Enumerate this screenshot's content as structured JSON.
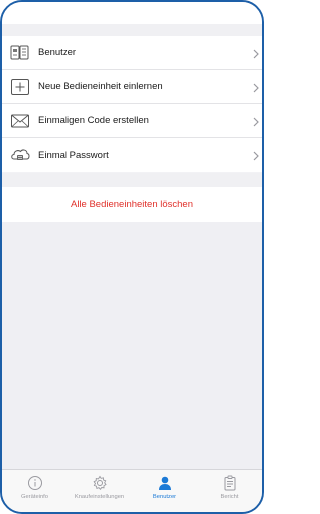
{
  "menu": {
    "items": [
      {
        "label": "Benutzer",
        "icon": "users-grid-icon"
      },
      {
        "label": "Neue Bedieneinheit einlernen",
        "icon": "plus-box-icon"
      },
      {
        "label": "Einmaligen Code erstellen",
        "icon": "code-envelope-icon"
      },
      {
        "label": "Einmal Passwort",
        "icon": "password-cloud-icon"
      }
    ]
  },
  "actions": {
    "delete_all_label": "Alle Bedieneinheiten löschen"
  },
  "tabbar": {
    "tabs": [
      {
        "label": "Geräteinfo",
        "icon": "info-icon",
        "active": false
      },
      {
        "label": "Knaufeinstellungen",
        "icon": "gear-icon",
        "active": false
      },
      {
        "label": "Benutzer",
        "icon": "user-icon",
        "active": true
      },
      {
        "label": "Bericht",
        "icon": "clipboard-icon",
        "active": false
      }
    ]
  },
  "colors": {
    "accent": "#1c7ad6",
    "danger": "#e0302a",
    "frame": "#1d5fa8"
  }
}
